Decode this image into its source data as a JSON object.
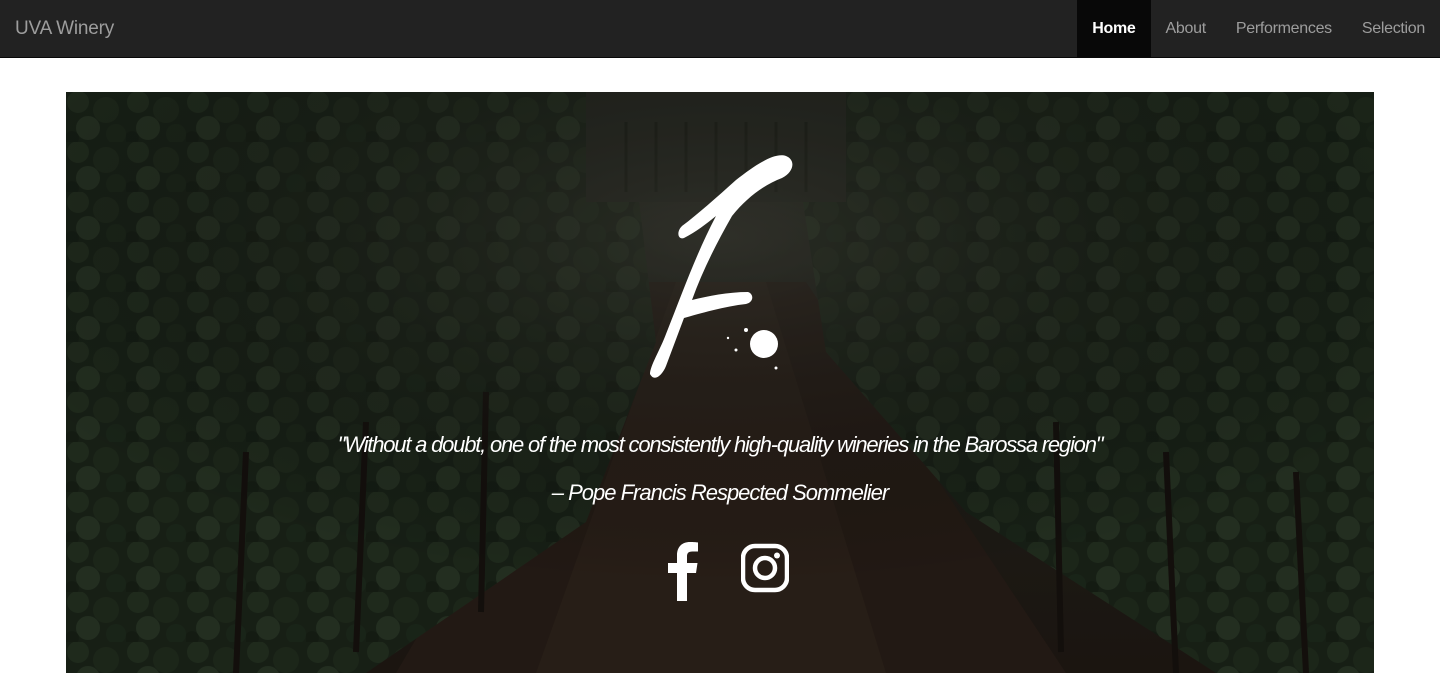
{
  "navbar": {
    "brand": "UVA Winery",
    "items": [
      {
        "label": "Home",
        "active": true
      },
      {
        "label": "About",
        "active": false
      },
      {
        "label": "Performences",
        "active": false
      },
      {
        "label": "Selection",
        "active": false
      }
    ]
  },
  "hero": {
    "background": "vineyard-rows-photo",
    "logo_icon": "brush-letter-f-logo",
    "quote": "\"Without a doubt, one of the most consistently high-quality wineries in the Barossa region\"",
    "author": "– Pope Francis Respected Sommelier",
    "social": [
      {
        "icon": "facebook-icon"
      },
      {
        "icon": "instagram-icon"
      }
    ]
  },
  "colors": {
    "navbar_bg": "#222222",
    "nav_active_bg": "#080808",
    "nav_text": "#9d9d9d",
    "hero_text": "#ffffff"
  }
}
